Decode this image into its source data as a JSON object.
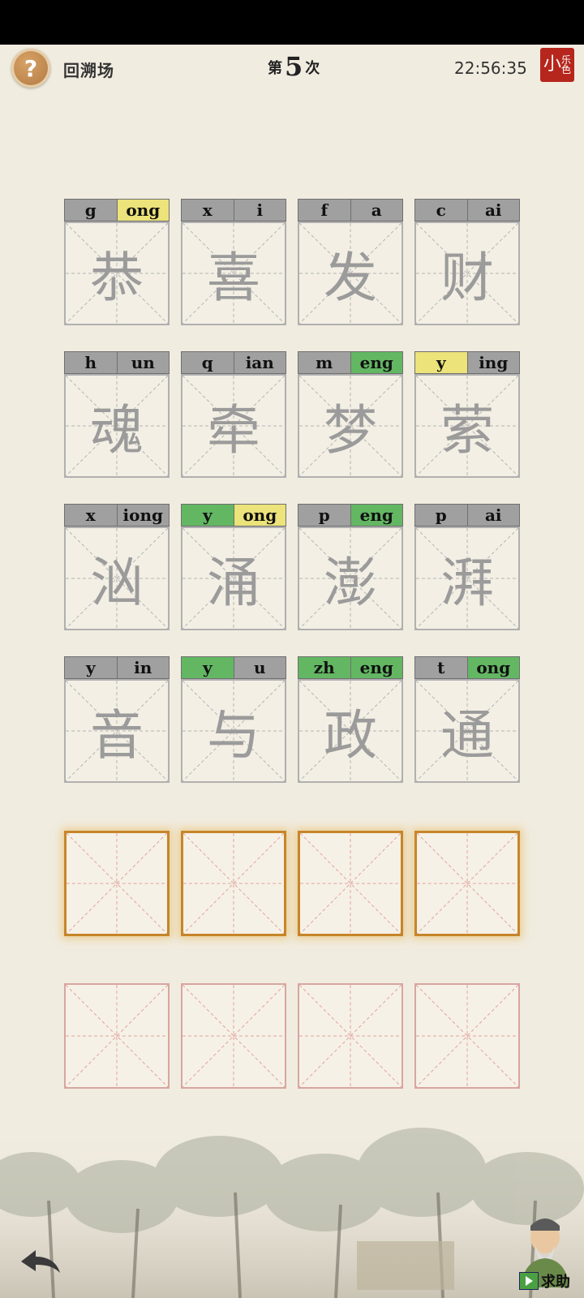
{
  "header": {
    "help_icon": "question-mark-icon",
    "help_label": "?",
    "scene_name": "回溯场",
    "round_prefix": "第",
    "round_number": "5",
    "round_suffix": "次",
    "clock": "22:56:35",
    "seal_big": "小",
    "seal_top": "乐",
    "seal_bottom": "色"
  },
  "cards": [
    {
      "initial": "g",
      "final": "ong",
      "hanzi": "恭",
      "initial_state": "gray",
      "final_state": "yellow"
    },
    {
      "initial": "x",
      "final": "i",
      "hanzi": "喜",
      "initial_state": "gray",
      "final_state": "gray"
    },
    {
      "initial": "f",
      "final": "a",
      "hanzi": "发",
      "initial_state": "gray",
      "final_state": "gray"
    },
    {
      "initial": "c",
      "final": "ai",
      "hanzi": "财",
      "initial_state": "gray",
      "final_state": "gray"
    },
    {
      "initial": "h",
      "final": "un",
      "hanzi": "魂",
      "initial_state": "gray",
      "final_state": "gray"
    },
    {
      "initial": "q",
      "final": "ian",
      "hanzi": "牵",
      "initial_state": "gray",
      "final_state": "gray"
    },
    {
      "initial": "m",
      "final": "eng",
      "hanzi": "梦",
      "initial_state": "gray",
      "final_state": "green"
    },
    {
      "initial": "y",
      "final": "ing",
      "hanzi": "萦",
      "initial_state": "yellow",
      "final_state": "gray"
    },
    {
      "initial": "x",
      "final": "iong",
      "hanzi": "汹",
      "initial_state": "gray",
      "final_state": "gray"
    },
    {
      "initial": "y",
      "final": "ong",
      "hanzi": "涌",
      "initial_state": "green",
      "final_state": "yellow"
    },
    {
      "initial": "p",
      "final": "eng",
      "hanzi": "澎",
      "initial_state": "gray",
      "final_state": "green"
    },
    {
      "initial": "p",
      "final": "ai",
      "hanzi": "湃",
      "initial_state": "gray",
      "final_state": "gray"
    },
    {
      "initial": "y",
      "final": "in",
      "hanzi": "音",
      "initial_state": "gray",
      "final_state": "gray"
    },
    {
      "initial": "y",
      "final": "u",
      "hanzi": "与",
      "initial_state": "green",
      "final_state": "gray"
    },
    {
      "initial": "zh",
      "final": "eng",
      "hanzi": "政",
      "initial_state": "green",
      "final_state": "green"
    },
    {
      "initial": "t",
      "final": "ong",
      "hanzi": "通",
      "initial_state": "gray",
      "final_state": "green"
    }
  ],
  "colors": {
    "green": "#63b763",
    "yellow": "#ece37a",
    "gray": "#a0a0a0",
    "active_border": "#c7862a"
  },
  "footer": {
    "back_icon": "back-arrow-icon",
    "hint_icon": "play-icon",
    "hint_label": "求助"
  }
}
